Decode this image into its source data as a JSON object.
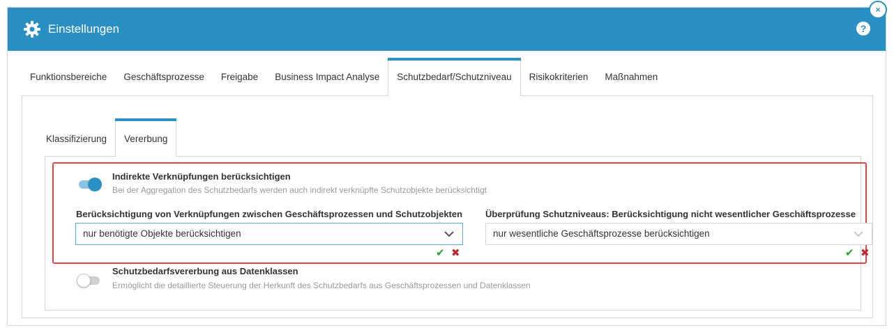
{
  "dialog": {
    "title": "Einstellungen",
    "help_label": "?",
    "close_label": "×"
  },
  "main_tabs": [
    {
      "label": "Funktionsbereiche",
      "active": false
    },
    {
      "label": "Geschäftsprozesse",
      "active": false
    },
    {
      "label": "Freigabe",
      "active": false
    },
    {
      "label": "Business Impact Analyse",
      "active": false
    },
    {
      "label": "Schutzbedarf/Schutzniveau",
      "active": true
    },
    {
      "label": "Risikokriterien",
      "active": false
    },
    {
      "label": "Maßnahmen",
      "active": false
    }
  ],
  "sub_tabs": [
    {
      "label": "Klassifizierung",
      "active": false
    },
    {
      "label": "Vererbung",
      "active": true
    }
  ],
  "options": {
    "indirect": {
      "enabled": true,
      "label": "Indirekte Verknüpfungen berücksichtigen",
      "description": "Bei der Aggregation des Schutzbedarfs werden auch indirekt verknüpfte Schutzobjekte berücksichtigt"
    },
    "dataclass": {
      "enabled": false,
      "label": "Schutzbedarfsvererbung aus Datenklassen",
      "description": "Ermöglicht die detaillierte Steuerung der Herkunft des Schutzbedarfs aus Geschäftsprozessen und Datenklassen"
    }
  },
  "fields": {
    "links": {
      "label": "Berücksichtigung von Verknüpfungen zwischen Geschäftsprozessen und Schutzobjekten",
      "value": "nur benötigte Objekte berücksichtigen"
    },
    "check": {
      "label": "Überprüfung Schutzniveaus: Berücksichtigung nicht wesentlicher Geschäftsprozesse",
      "value": "nur wesentliche Geschäftsprozesse berücksichtigen"
    }
  },
  "icons": {
    "ok": "✔",
    "cancel": "✖"
  },
  "colors": {
    "accent": "#2a8fc2",
    "highlight": "#e0454a",
    "ok": "#2e9a2e",
    "cancel": "#c0262d"
  }
}
